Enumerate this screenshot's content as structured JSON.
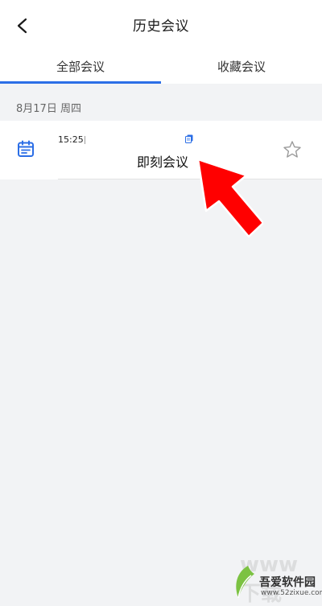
{
  "header": {
    "title": "历史会议",
    "back_icon": "chevron-left-icon"
  },
  "tabs": [
    {
      "label": "全部会议",
      "active": true
    },
    {
      "label": "收藏会议",
      "active": false
    }
  ],
  "accent_color": "#2b6ee6",
  "meetings": {
    "date_label": "8月17日  周四",
    "items": [
      {
        "time": "15:25",
        "name": "即刻会议",
        "icon": "calendar-icon",
        "favorite": false
      }
    ]
  },
  "overlay": {
    "arrow_color": "#ff0000"
  },
  "watermark": {
    "site_name": "吾爱软件园",
    "url": "www.52zixue.com",
    "faint_text": "www下载"
  }
}
